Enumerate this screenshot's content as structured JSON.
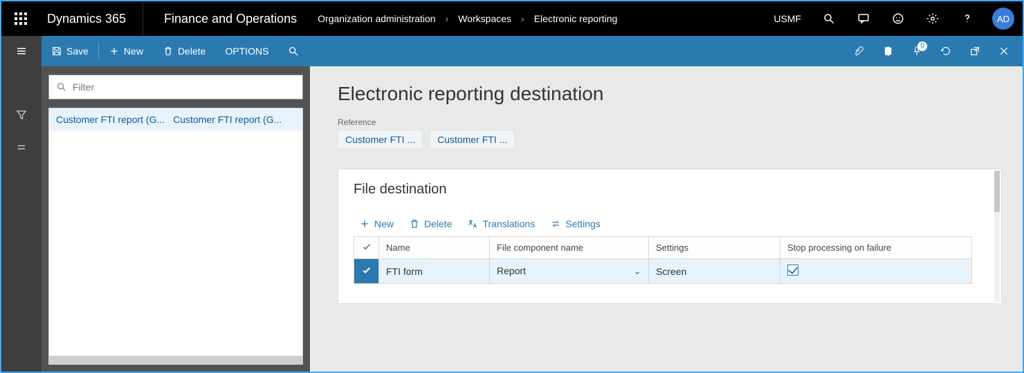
{
  "topbar": {
    "brand": "Dynamics 365",
    "module": "Finance and Operations",
    "breadcrumbs": [
      "Organization administration",
      "Workspaces",
      "Electronic reporting"
    ],
    "entity": "USMF",
    "avatar": "AD"
  },
  "actionbar": {
    "save": "Save",
    "new": "New",
    "delete": "Delete",
    "options": "OPTIONS",
    "badge": "0"
  },
  "leftpane": {
    "filter_placeholder": "Filter",
    "rows": [
      {
        "c1": "Customer FTI report (G...",
        "c2": "Customer FTI report (G..."
      }
    ]
  },
  "main": {
    "title": "Electronic reporting destination",
    "reference_label": "Reference",
    "reference_pills": [
      "Customer FTI ...",
      "Customer FTI ..."
    ],
    "card": {
      "title": "File destination",
      "cmds": {
        "new": "New",
        "delete": "Delete",
        "translations": "Translations",
        "settings": "Settings"
      },
      "columns": [
        "Name",
        "File component name",
        "Settings",
        "Stop processing on failure"
      ],
      "row": {
        "name": "FTI form",
        "component": "Report",
        "settings": "Screen",
        "stop_on_failure": true
      }
    }
  }
}
